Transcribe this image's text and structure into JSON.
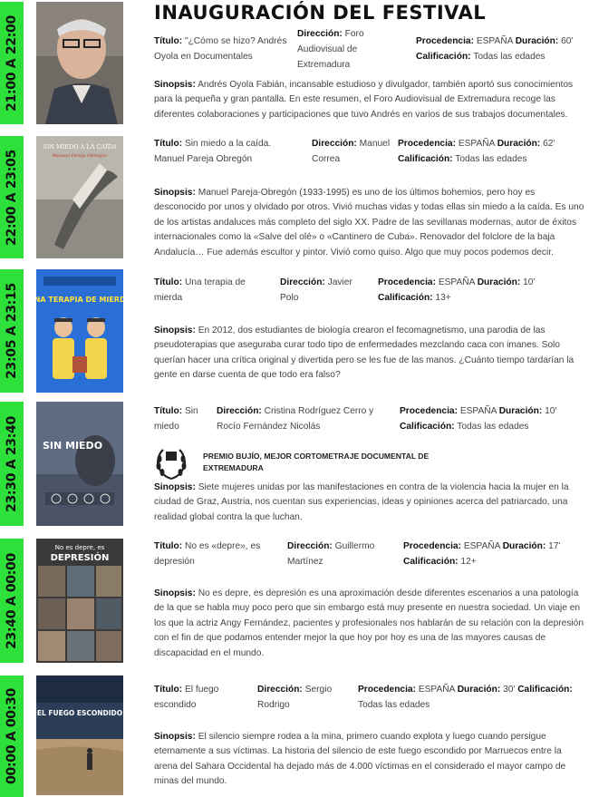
{
  "header": {
    "title": "INAUGURACIÓN DEL FESTIVAL"
  },
  "labels": {
    "titulo": "Título:",
    "direccion": "Dirección:",
    "procedencia": "Procedencia:",
    "duracion": "Duración:",
    "calificacion": "Calificación:",
    "sinopsis": "Sinopsis:"
  },
  "films": [
    {
      "time": "21:00 A 22:00",
      "title": "\"¿Cómo se hizo? Andrés Oyola en Documentales",
      "direction": "Foro Audiovisual de Extremadura",
      "origin": "ESPAÑA",
      "duration": "60'",
      "rating": "Todas las edades",
      "synopsis": "Andrés Oyola Fabián, incansable estudioso y divulgador, también aportó sus conocimientos para la pequeña y gran pantalla. En este resumen, el Foro Audiovisual de Extremadura recoge las diferentes colaboraciones y participaciones que tuvo Andrés en varios de sus trabajos documentales.",
      "poster_colors": {
        "bg": "#6f6a63",
        "accent": "#d9c6b3"
      }
    },
    {
      "time": "22:00 A 23:05",
      "title": "Sin miedo a la caída. Manuel Pareja Obregón",
      "direction": "Manuel Correa",
      "origin": "ESPAÑA",
      "duration": "62'",
      "rating": "Todas las edades",
      "synopsis": "Manuel Pareja-Obregón (1933-1995) es uno de los últimos bohemios, pero hoy es desconocido por unos y olvidado por otros. Vivió muchas vidas y todas ellas sin miedo a la caída. Es uno de los artistas andaluces más completo del siglo XX. Padre de las sevillanas modernas, autor de éxitos internacionales como la «Salve del olé» o «Cantinero de Cuba». Renovador del folclore de la baja Andalucía… Fue además escultor y pintor. Vivió como quiso. Algo que muy pocos podemos decir.",
      "poster_text": "SIN MIEDO A LA CAÍDA",
      "poster_subtitle": "Manuel Pareja Obregón"
    },
    {
      "time": "23:05 A 23:15",
      "title": "Una terapia de mierda",
      "direction": "Javier Polo",
      "origin": "ESPAÑA",
      "duration": "10'",
      "rating": "13+",
      "synopsis": "En 2012, dos estudiantes de biología crearon el fecomagnetismo, una parodia de las pseudoterapias que aseguraba curar todo tipo de enfermedades mezclando caca con imanes. Solo querían hacer una crítica original y divertida pero se les fue de las manos. ¿Cuánto tiempo tardarían la gente en darse cuenta de que todo era falso?",
      "poster_text": "UNA TERAPIA DE MIERDA"
    },
    {
      "time": "23:30 A 23:40",
      "title": "Sin miedo",
      "direction": "Cristina Rodríguez Cerro y Rocío Fernández Nicolás",
      "origin": "ESPAÑA",
      "duration": "10'",
      "rating": "Todas las edades",
      "award": "PREMIO BUJÍO, MEJOR CORTOMETRAJE DOCUMENTAL DE EXTREMADURA",
      "synopsis": "Siete mujeres unidas por las manifestaciones en contra de la violencia hacia la mujer en la ciudad de Graz, Austria, nos cuentan sus experiencias, ideas y opiniones acerca del patriarcado, una realidad global contra la que luchan.",
      "poster_text": "SIN MIEDO"
    },
    {
      "time": "23:40 A 00:00",
      "title": "No es «depre», es depresión",
      "direction": "Guillermo Martínez",
      "origin": "ESPAÑA",
      "duration": "17'",
      "rating": "12+",
      "synopsis": "No es depre, es depresión es una aproximación desde diferentes escenarios a una patología de la que se habla muy poco pero que sin embargo está muy presente en nuestra sociedad. Un viaje en los que la actriz Angy Fernández, pacientes y profesionales nos hablarán de su relación con la depresión con el fin de que podamos entender mejor la que hoy por hoy es una de las mayores causas de discapacidad en el mundo.",
      "poster_text_1": "No es depre, es",
      "poster_text_2": "DEPRESIÓN"
    },
    {
      "time": "00:00 A 00:30",
      "title": "El fuego escondido",
      "direction": "Sergio Rodrigo",
      "origin": "ESPAÑA",
      "duration": "30'",
      "rating": "Todas las edades",
      "synopsis": "El silencio siempre rodea a la mina, primero cuando explota y luego cuando persigue eternamente a sus víctimas. La historia del silencio de este fuego escondido por Marruecos entre la arena del Sahara Occidental ha dejado más de 4.000 víctimas en el considerado el mayor campo de minas del mundo.",
      "poster_text": "EL FUEGO ESCONDIDO"
    }
  ],
  "colors": {
    "timebar": "#2ee03a",
    "text": "#444444",
    "label": "#111111"
  }
}
